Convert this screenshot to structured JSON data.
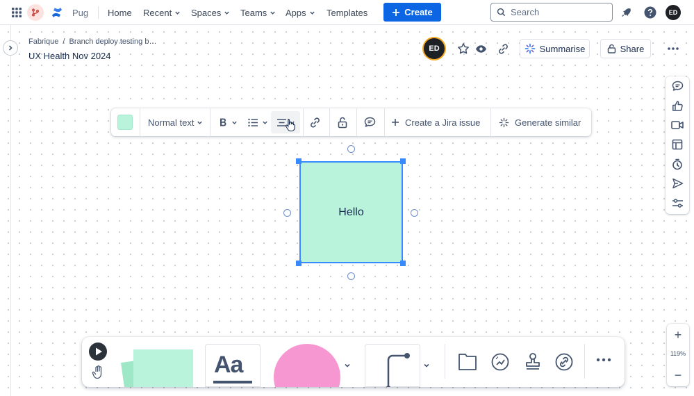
{
  "topnav": {
    "product_name": "Pug",
    "links": [
      {
        "label": "Home",
        "has_menu": false
      },
      {
        "label": "Recent",
        "has_menu": true
      },
      {
        "label": "Spaces",
        "has_menu": true
      },
      {
        "label": "Teams",
        "has_menu": true
      },
      {
        "label": "Apps",
        "has_menu": true
      },
      {
        "label": "Templates",
        "has_menu": false
      }
    ],
    "create_label": "Create",
    "search_placeholder": "Search",
    "avatar_initials": "ED",
    "icons": [
      "app-switcher-icon",
      "branch-icon",
      "confluence-logo-icon",
      "notifications-icon",
      "help-icon"
    ]
  },
  "page": {
    "breadcrumb": [
      "Fabrique",
      "Branch deploy testing b…"
    ],
    "breadcrumb_sep": "/",
    "title": "UX Health Nov 2024",
    "owner_initials": "ED",
    "summarise_label": "Summarise",
    "share_label": "Share"
  },
  "format_toolbar": {
    "swatch_color": "#baf3db",
    "text_style": "Normal text",
    "jira_label": "Create a Jira issue",
    "generate_label": "Generate similar"
  },
  "canvas": {
    "sticky_text": "Hello",
    "sticky_color": "#baf3db",
    "selection_color": "#388bff"
  },
  "right_rail": [
    "comments-icon",
    "reactions-icon",
    "video-icon",
    "templates-icon",
    "timer-icon",
    "send-icon",
    "settings-sliders-icon"
  ],
  "zoom": {
    "level": "119%",
    "in_label": "+",
    "out_label": "−"
  },
  "dock": {
    "text_tool_label": "Aa",
    "tools": [
      "play-icon",
      "hand-icon",
      "sticky-notes",
      "text-tool",
      "shape-tool",
      "connector-tool",
      "frame-icon",
      "ai-icon",
      "stamp-icon",
      "link-icon",
      "more-icon"
    ]
  },
  "colors": {
    "accent": "#0c66e4",
    "sticky": "#baf3db",
    "shape": "#f797d2"
  }
}
